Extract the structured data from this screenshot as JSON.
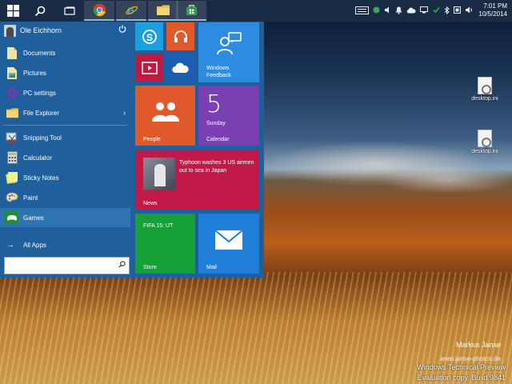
{
  "taskbar": {
    "pinned_apps": [
      "chrome-icon",
      "internet-explorer-icon",
      "file-explorer-icon",
      "store-icon"
    ],
    "tray_icons": [
      "keyboard-icon",
      "network-status-icon",
      "speaker-icon",
      "notification-icon",
      "onedrive-icon",
      "network-icon",
      "bluetooth-icon",
      "action-center-icon",
      "volume-icon"
    ],
    "time": "7:01 PM",
    "date": "10/5/2014"
  },
  "start_menu": {
    "user_name": "Ole Eichhorn",
    "places": [
      {
        "label": "Documents",
        "icon": "documents-icon"
      },
      {
        "label": "Pictures",
        "icon": "pictures-icon"
      },
      {
        "label": "PC settings",
        "icon": "settings-icon"
      },
      {
        "label": "File Explorer",
        "icon": "file-explorer-icon"
      }
    ],
    "apps": [
      {
        "label": "Snipping Tool",
        "icon": "snipping-tool-icon"
      },
      {
        "label": "Calculator",
        "icon": "calculator-icon"
      },
      {
        "label": "Sticky Notes",
        "icon": "sticky-notes-icon"
      },
      {
        "label": "Paint",
        "icon": "paint-icon"
      },
      {
        "label": "Games",
        "icon": "games-icon"
      }
    ],
    "all_apps_label": "All Apps",
    "search_placeholder": ""
  },
  "tiles": {
    "feedback_label": "Windows Feedback",
    "people_label": "People",
    "calendar_day": "5",
    "calendar_weekday": "Sunday",
    "calendar_label": "Calendar",
    "news_headline": "Typhoon washes 3 US airmen out to sea in Japan",
    "news_label": "News",
    "store_text": "FIFA 15: UT",
    "store_label": "Store",
    "mail_label": "Mail"
  },
  "desktop": {
    "icons": [
      {
        "label": "desktop.ini"
      },
      {
        "label": "desktop.ini"
      }
    ],
    "watermark": {
      "photographer": "Markus Janse",
      "site": "www.janse-photos.de",
      "product": "Windows Technical Preview",
      "build": "Evaluation copy. Build 9841"
    }
  },
  "colors": {
    "taskbar": "#1a2b45",
    "start_menu": "#1e5f9c",
    "tile_blue": "#2d8ce0",
    "tile_orange": "#e0592a",
    "tile_purple": "#7a3fb0",
    "tile_red": "#c1194a",
    "tile_green": "#16a035"
  }
}
